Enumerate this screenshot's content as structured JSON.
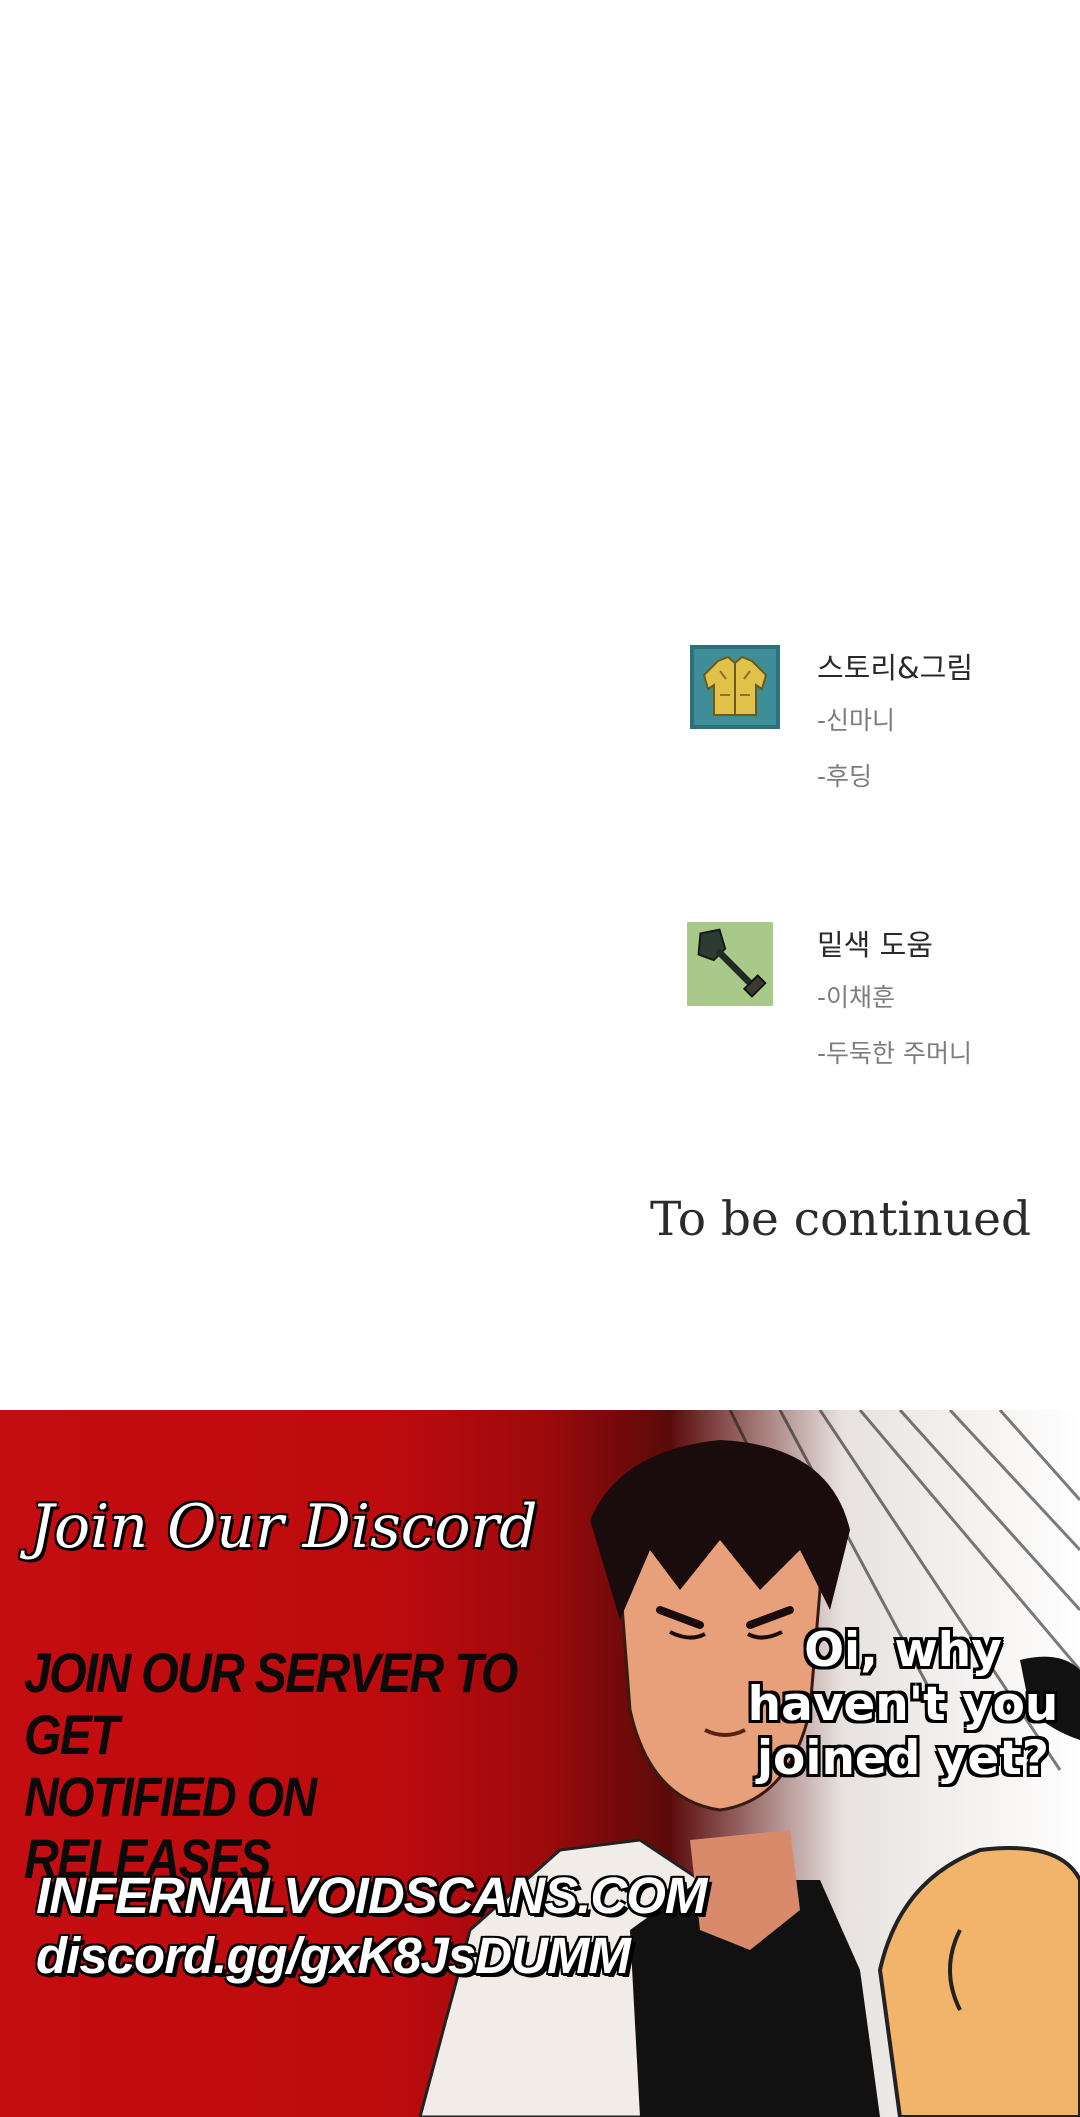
{
  "credits": {
    "story_art": {
      "heading": "스토리&그림",
      "names": [
        "-신마니",
        "-후딩"
      ],
      "icon": "jacket-icon"
    },
    "assist": {
      "heading": "밑색 도움",
      "names": [
        "-이채훈",
        "-두둑한 주머니"
      ],
      "icon": "shovel-icon"
    },
    "ending": "To be continued"
  },
  "banner": {
    "title": "Join Our Discord",
    "server_lines": [
      "JOIN OUR SERVER TO GET",
      "NOTIFIED ON RELEASES"
    ],
    "website": "INFERNALVOIDSCANS.COM",
    "discord_link": "discord.gg/gxK8JsDUMM",
    "speech_lines": [
      "Oi, why",
      "haven't you",
      "joined yet?"
    ],
    "colors": {
      "red": "#c40d10",
      "dark_red": "#5a0a0a",
      "white": "#ffffff",
      "black": "#000000"
    }
  }
}
